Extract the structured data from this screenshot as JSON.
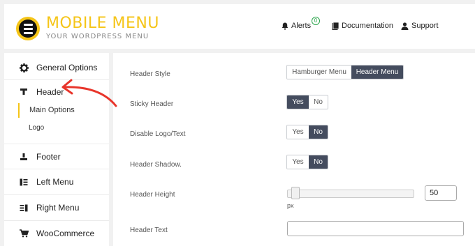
{
  "brand": {
    "title": "MOBILE MENU",
    "subtitle": "YOUR WORDPRESS MENU"
  },
  "top_nav": {
    "alerts": {
      "label": "Alerts",
      "count": "0"
    },
    "documentation": "Documentation",
    "support": "Support"
  },
  "sidebar": {
    "items": {
      "general": "General Options",
      "header": "Header",
      "footer": "Footer",
      "left_menu": "Left Menu",
      "right_menu": "Right Menu",
      "woocommerce": "WooCommerce"
    },
    "header_sub": {
      "main_options": "Main Options",
      "logo": "Logo"
    }
  },
  "fields": {
    "header_style": {
      "label": "Header Style",
      "options": [
        "Hamburger Menu",
        "Header Menu"
      ],
      "selected": "Header Menu"
    },
    "sticky_header": {
      "label": "Sticky Header",
      "options": [
        "Yes",
        "No"
      ],
      "selected": "Yes"
    },
    "disable_logo": {
      "label": "Disable Logo/Text",
      "options": [
        "Yes",
        "No"
      ],
      "selected": "No"
    },
    "header_shadow": {
      "label": "Header Shadow.",
      "options": [
        "Yes",
        "No"
      ],
      "selected": "No"
    },
    "header_height": {
      "label": "Header Height",
      "value": "50",
      "unit": "px",
      "slider_fraction": 0.05
    },
    "header_text": {
      "label": "Header Text",
      "value": ""
    }
  },
  "colors": {
    "accent": "#f5c518",
    "toggle_on": "#444c5e",
    "annotation_arrow": "#e8352b"
  }
}
